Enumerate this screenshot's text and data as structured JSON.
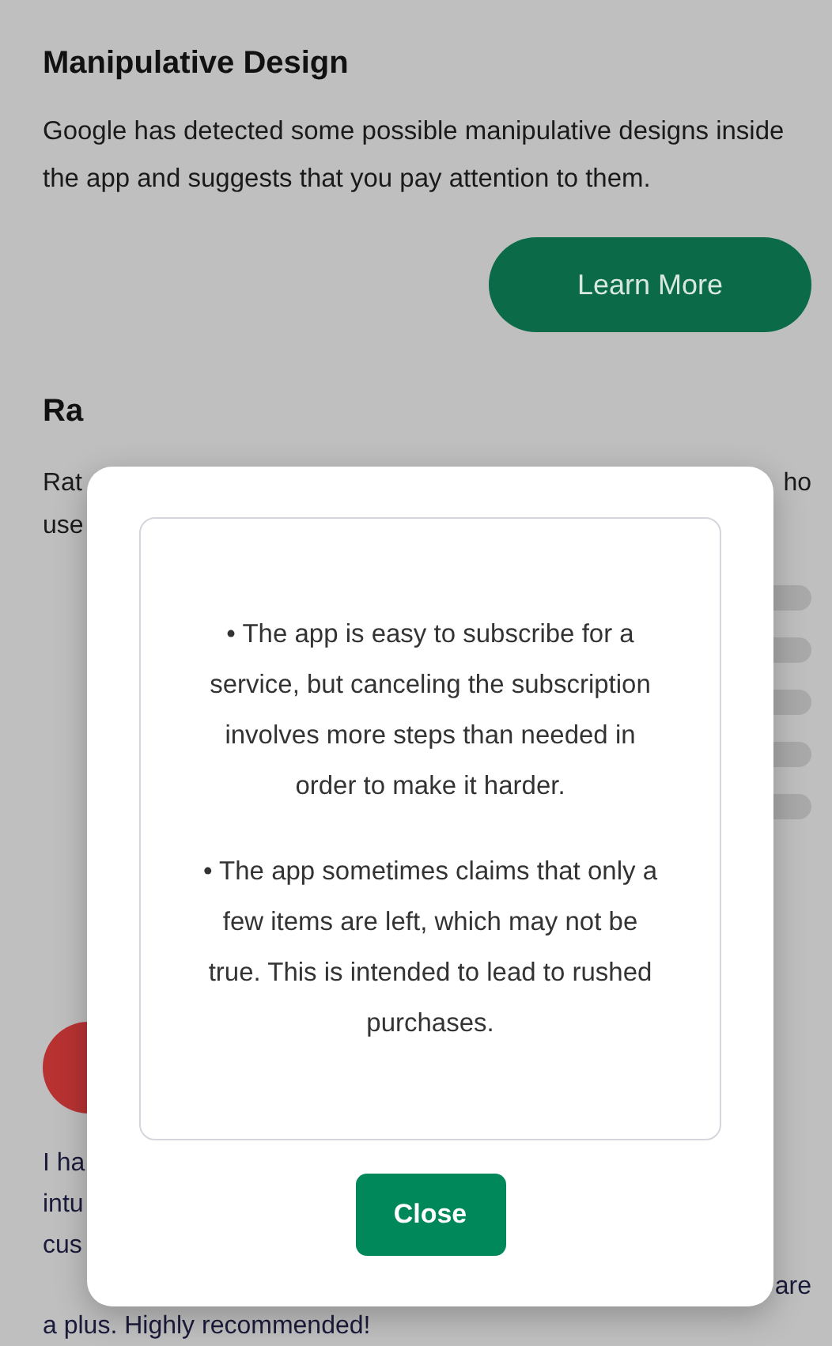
{
  "section": {
    "title": "Manipulative Design",
    "body": "Google has detected some possible manipulative designs inside the app and suggests that you pay attention to them.",
    "button": "Learn More"
  },
  "ratings": {
    "title_fragment": "Ra",
    "lines": [
      {
        "left": "Rat",
        "right": "ho"
      },
      {
        "left": "use"
      }
    ]
  },
  "review": {
    "lines": [
      {
        "left": "I ha"
      },
      {
        "left": "intu"
      },
      {
        "left": "cus"
      },
      {
        "right": "are"
      },
      {
        "left": "a plus. Highly recommended!"
      }
    ]
  },
  "dialog": {
    "items": [
      "• The app is easy to subscribe for a service, but canceling the subscription involves more steps than needed in order to make it harder.",
      "• The app sometimes claims that only a few items are left, which may not be true. This is intended to lead to rushed purchases."
    ],
    "button": "Close"
  }
}
